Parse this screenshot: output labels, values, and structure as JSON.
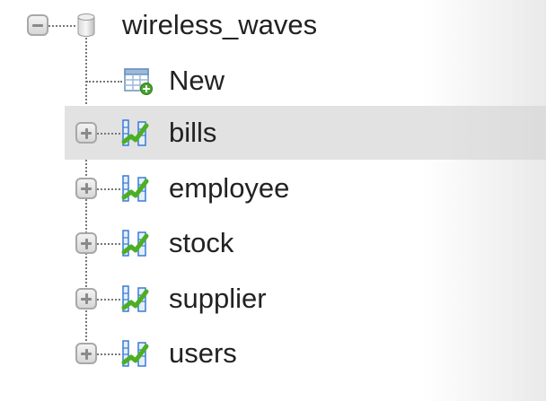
{
  "database": {
    "name": "wireless_waves",
    "expanded": true
  },
  "new_item": {
    "label": "New"
  },
  "tables": [
    {
      "label": "bills",
      "selected": true
    },
    {
      "label": "employee",
      "selected": false
    },
    {
      "label": "stock",
      "selected": false
    },
    {
      "label": "supplier",
      "selected": false
    },
    {
      "label": "users",
      "selected": false
    }
  ],
  "icons": {
    "collapse": "minus-toggle-icon",
    "expand": "plus-toggle-icon",
    "database": "database-icon",
    "new": "new-table-icon",
    "table": "table-icon"
  },
  "colors": {
    "selected_row": "#e2e2e2",
    "text": "#222222",
    "tree_line": "#777777",
    "icon_green": "#4caf23",
    "icon_blue": "#3a7bd5"
  }
}
